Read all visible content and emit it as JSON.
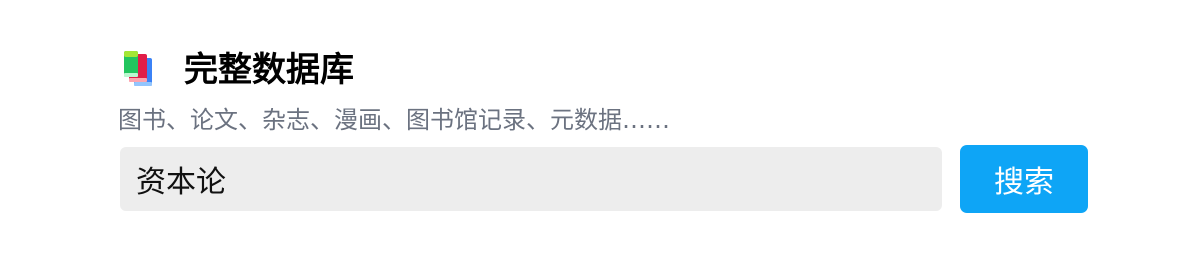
{
  "header": {
    "icon": "books-icon",
    "title": "完整数据库"
  },
  "subtitle": "图书、论文、杂志、漫画、图书馆记录、元数据……",
  "search": {
    "value": "资本论",
    "button_label": "搜索"
  },
  "colors": {
    "button_bg": "#0ea5f6",
    "input_bg": "#ededed",
    "subtitle_text": "#6b7280"
  }
}
